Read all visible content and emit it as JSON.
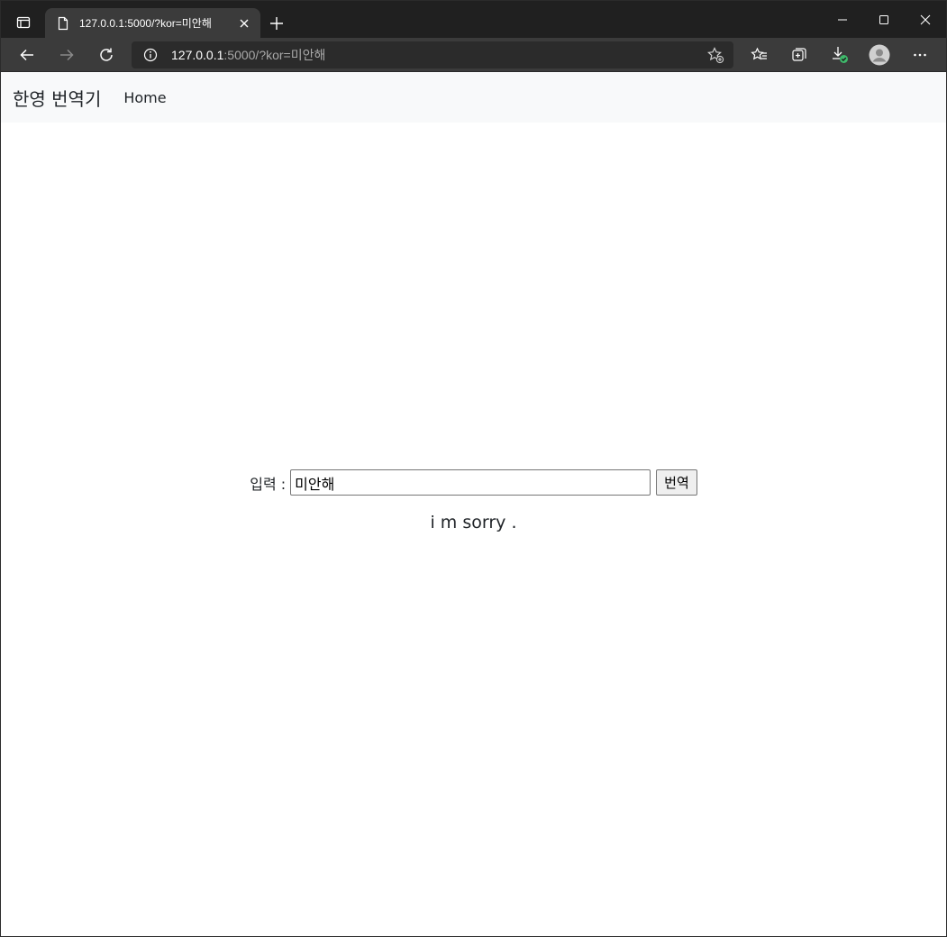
{
  "browser": {
    "tab": {
      "title": "127.0.0.1:5000/?kor=미안해"
    },
    "address": {
      "host": "127.0.0.1",
      "rest": ":5000/?kor=미안해"
    },
    "colors": {
      "frame": "#202020",
      "toolbar": "#3b3b3b",
      "omnibox": "#2b2b2b",
      "download_badge": "#3fb96b"
    }
  },
  "page": {
    "brand": "한영 번역기",
    "nav": {
      "home": "Home"
    },
    "form": {
      "label": "입력 :",
      "input_value": "미안해",
      "submit_label": "번역"
    },
    "result": "i m sorry ."
  }
}
